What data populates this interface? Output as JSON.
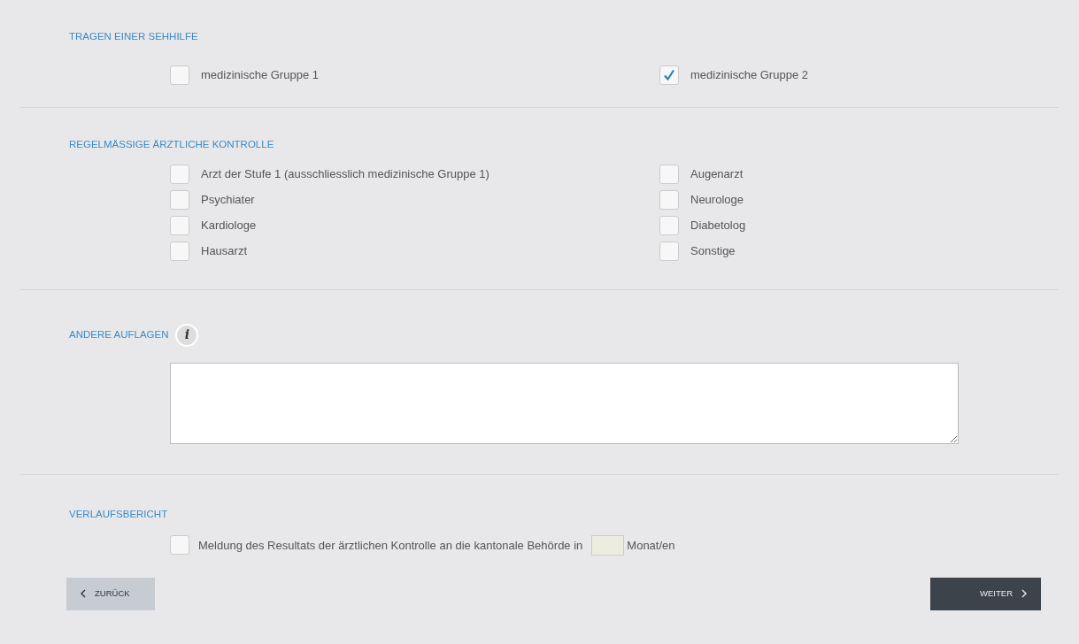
{
  "sections": [
    {
      "kind": "checkboxes",
      "heading": "TRAGEN EINER SEHHILFE",
      "columns": [
        [
          {
            "label": "medizinische Gruppe 1",
            "checked": false
          }
        ],
        [
          {
            "label": "medizinische Gruppe 2",
            "checked": true
          }
        ]
      ]
    },
    {
      "kind": "checkboxes",
      "heading": "REGELMÄSSIGE ÄRZTLICHE KONTROLLE",
      "columns": [
        [
          {
            "label": "Arzt der Stufe 1 (ausschliesslich medizinische Gruppe 1)",
            "checked": false
          },
          {
            "label": "Psychiater",
            "checked": false
          },
          {
            "label": "Kardiologe",
            "checked": false
          },
          {
            "label": "Hausarzt",
            "checked": false
          }
        ],
        [
          {
            "label": "Augenarzt",
            "checked": false
          },
          {
            "label": "Neurologe",
            "checked": false
          },
          {
            "label": "Diabetolog",
            "checked": false
          },
          {
            "label": "Sonstige",
            "checked": false
          }
        ]
      ]
    },
    {
      "kind": "textarea",
      "heading": "ANDERE AUFLAGEN",
      "info_glyph": "i"
    },
    {
      "kind": "report",
      "heading": "VERLAUFSBERICHT",
      "checked": false,
      "text_before": "Meldung des Resultats der ärztlichen Kontrolle an die kantonale Behörde in",
      "text_after": "Monat/en"
    }
  ],
  "buttons": [
    {
      "kind": "back",
      "label": "ZURÜCK"
    },
    {
      "kind": "next",
      "label": "WEITER"
    }
  ]
}
